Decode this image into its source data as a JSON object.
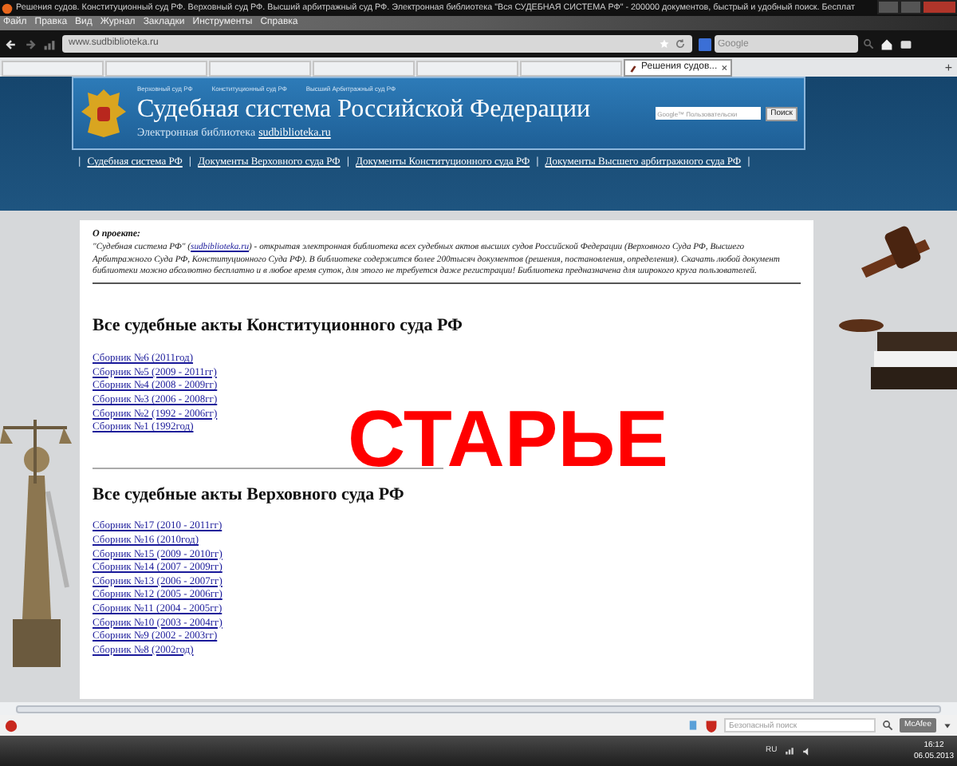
{
  "window": {
    "title": "Решения судов. Конституционный суд РФ. Верховный суд РФ. Высший арбитражный суд РФ. Электронная библиотека \"Вся СУДЕБНАЯ СИСТЕМА РФ\" - 200000 документов, быстрый и удобный поиск. Бесплат"
  },
  "menu": [
    "Файл",
    "Правка",
    "Вид",
    "Журнал",
    "Закладки",
    "Инструменты",
    "Справка"
  ],
  "navigation": {
    "url": "www.sudbiblioteka.ru",
    "search_placeholder": "Google"
  },
  "tabs": [
    {
      "selected": false
    },
    {
      "selected": false
    },
    {
      "selected": false
    },
    {
      "selected": false
    },
    {
      "selected": false
    },
    {
      "selected": false
    },
    {
      "label": "Решения судов...",
      "selected": true
    }
  ],
  "new_tab": "+",
  "header": {
    "top_links": [
      "Верховный суд РФ",
      "Конституционный суд РФ",
      "Высший Арбитражный суд РФ"
    ],
    "title": "Судебная система Российской Федерации",
    "subtitle": "Электронная библиотека",
    "subtitle_link": "sudbiblioteka.ru",
    "search_placeholder": "Google™ Пользовательски",
    "search_button": "Поиск"
  },
  "site_nav": [
    {
      "kind": "separator",
      "label": "|"
    },
    {
      "kind": "link",
      "label": "Судебная система РФ"
    },
    {
      "kind": "separator",
      "label": "|"
    },
    {
      "kind": "link",
      "label": "Документы Верховного суда РФ"
    },
    {
      "kind": "separator",
      "label": "|"
    },
    {
      "kind": "link",
      "label": "Документы Конституционного суда РФ"
    },
    {
      "kind": "separator",
      "label": "|"
    },
    {
      "kind": "link",
      "label": "Документы Высшего арбитражного суда РФ"
    },
    {
      "kind": "separator",
      "label": "|"
    }
  ],
  "about": {
    "heading": "О проекте:",
    "text_before": "\"Судебная система РФ\" (",
    "link": "sudbiblioteka.ru",
    "text_after": ") - открытая электронная библиотека всех судебных актов высших судов Российской Федерации (Верховного Суда РФ, Высшего Арбитражного Суда РФ, Конституционного Суда РФ). В библиотеке содержится более 200тысяч документов (решения, постановления, определения). Скачать любой документ библиотеки можно абсолютно бесплатно и в любое время суток, для этого не требуется даже регистрации! Библиотека предназначена для широкого круга пользователей."
  },
  "sections": [
    {
      "heading": "Все судебные акты Конституционного суда РФ",
      "links": [
        "Сборник №6 (2011год)",
        "Сборник №5 (2009 - 2011гг)",
        "Сборник №4 (2008 - 2009гг)",
        "Сборник №3 (2006 - 2008гг)",
        "Сборник №2 (1992 - 2006гг)",
        "Сборник №1 (1992год)"
      ]
    },
    {
      "heading": "Все судебные акты Верховного суда РФ",
      "links": [
        "Сборник №17 (2010 - 2011гг)",
        "Сборник №16 (2010год)",
        "Сборник №15 (2009 - 2010гг)",
        "Сборник №14 (2007 - 2009гг)",
        "Сборник №13 (2006 - 2007гг)",
        "Сборник №12 (2005 - 2006гг)",
        "Сборник №11 (2004 - 2005гг)",
        "Сборник №10 (2003 - 2004гг)",
        "Сборник №9 (2002 - 2003гг)",
        "Сборник №8 (2002год)"
      ]
    }
  ],
  "overlay_text": "СТАРЬЕ",
  "status_bar": {
    "search_placeholder": "Безопасный поиск",
    "mcafee": "McAfee"
  },
  "taskbar": {
    "language": "RU",
    "time": "16:12",
    "date": "06.05.2013"
  }
}
